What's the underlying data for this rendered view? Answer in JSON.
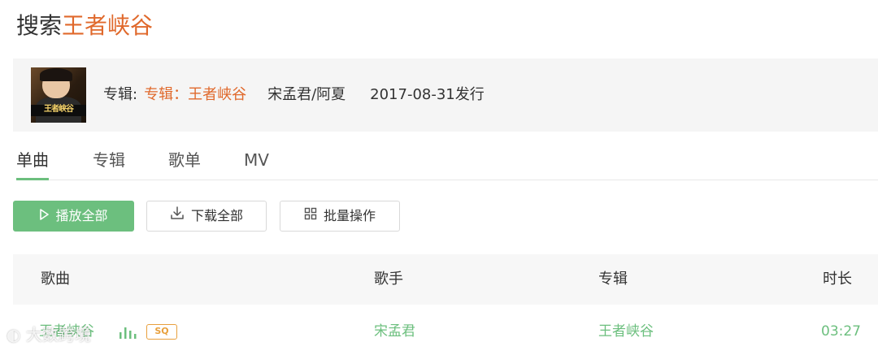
{
  "search": {
    "prefix": "搜索",
    "keyword": "王者峡谷"
  },
  "album": {
    "cover_title": "王者峡谷",
    "label": "专辑:",
    "name": "专辑：王者峡谷",
    "artists": "宋孟君/阿夏",
    "release": "2017-08-31发行"
  },
  "tabs": [
    {
      "label": "单曲",
      "active": true
    },
    {
      "label": "专辑",
      "active": false
    },
    {
      "label": "歌单",
      "active": false
    },
    {
      "label": "MV",
      "active": false
    }
  ],
  "actions": {
    "play_all": "播放全部",
    "download_all": "下载全部",
    "batch": "批量操作"
  },
  "table": {
    "headers": [
      "歌曲",
      "歌手",
      "专辑",
      "时长"
    ],
    "rows": [
      {
        "song": "王者峡谷",
        "quality": "SQ",
        "artist": "宋孟君",
        "album": "王者峡谷",
        "duration": "03:27"
      }
    ]
  },
  "watermark": "大数跨境",
  "colors": {
    "accent_green": "#6cbf7e",
    "accent_orange": "#e0692c",
    "sq_badge": "#e8a03d"
  }
}
